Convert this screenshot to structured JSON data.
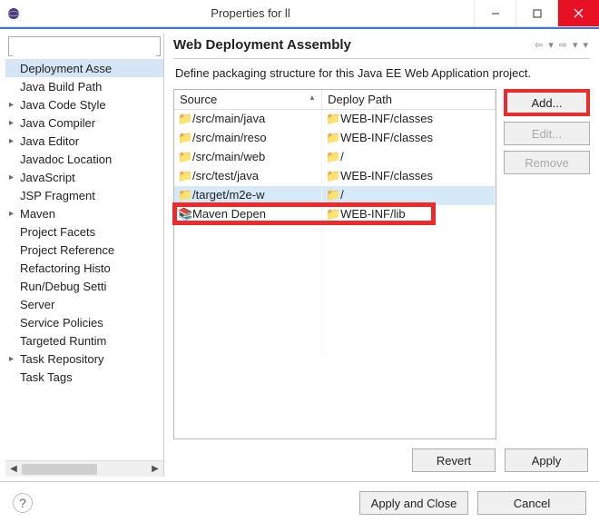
{
  "window": {
    "title": "Properties for ll"
  },
  "sidebar": {
    "filter_placeholder": "",
    "items": [
      {
        "label": "Deployment Asse",
        "expandable": false,
        "selected": true
      },
      {
        "label": "Java Build Path",
        "expandable": false
      },
      {
        "label": "Java Code Style",
        "expandable": true
      },
      {
        "label": "Java Compiler",
        "expandable": true
      },
      {
        "label": "Java Editor",
        "expandable": true
      },
      {
        "label": "Javadoc Location",
        "expandable": false
      },
      {
        "label": "JavaScript",
        "expandable": true
      },
      {
        "label": "JSP Fragment",
        "expandable": false
      },
      {
        "label": "Maven",
        "expandable": true
      },
      {
        "label": "Project Facets",
        "expandable": false
      },
      {
        "label": "Project Reference",
        "expandable": false
      },
      {
        "label": "Refactoring Histo",
        "expandable": false
      },
      {
        "label": "Run/Debug Setti",
        "expandable": false
      },
      {
        "label": "Server",
        "expandable": false
      },
      {
        "label": "Service Policies",
        "expandable": false
      },
      {
        "label": "Targeted Runtim",
        "expandable": false
      },
      {
        "label": "Task Repository",
        "expandable": true
      },
      {
        "label": "Task Tags",
        "expandable": false
      }
    ]
  },
  "main": {
    "heading": "Web Deployment Assembly",
    "description": "Define packaging structure for this Java EE Web Application project.",
    "columns": {
      "source": "Source",
      "deploy": "Deploy Path"
    },
    "rows": [
      {
        "source": "/src/main/java",
        "deploy": "WEB-INF/classes",
        "icon": "folder"
      },
      {
        "source": "/src/main/reso",
        "deploy": "WEB-INF/classes",
        "icon": "folder"
      },
      {
        "source": "/src/main/web",
        "deploy": "/",
        "icon": "folder"
      },
      {
        "source": "/src/test/java",
        "deploy": "WEB-INF/classes",
        "icon": "folder"
      },
      {
        "source": "/target/m2e-w",
        "deploy": "/",
        "icon": "folder",
        "selected": true
      },
      {
        "source": "Maven Depen",
        "deploy": "WEB-INF/lib",
        "icon": "library",
        "highlighted": true
      }
    ],
    "buttons": {
      "add": "Add...",
      "edit": "Edit...",
      "remove": "Remove",
      "revert": "Revert",
      "apply": "Apply"
    }
  },
  "footer": {
    "apply_close": "Apply and Close",
    "cancel": "Cancel"
  }
}
